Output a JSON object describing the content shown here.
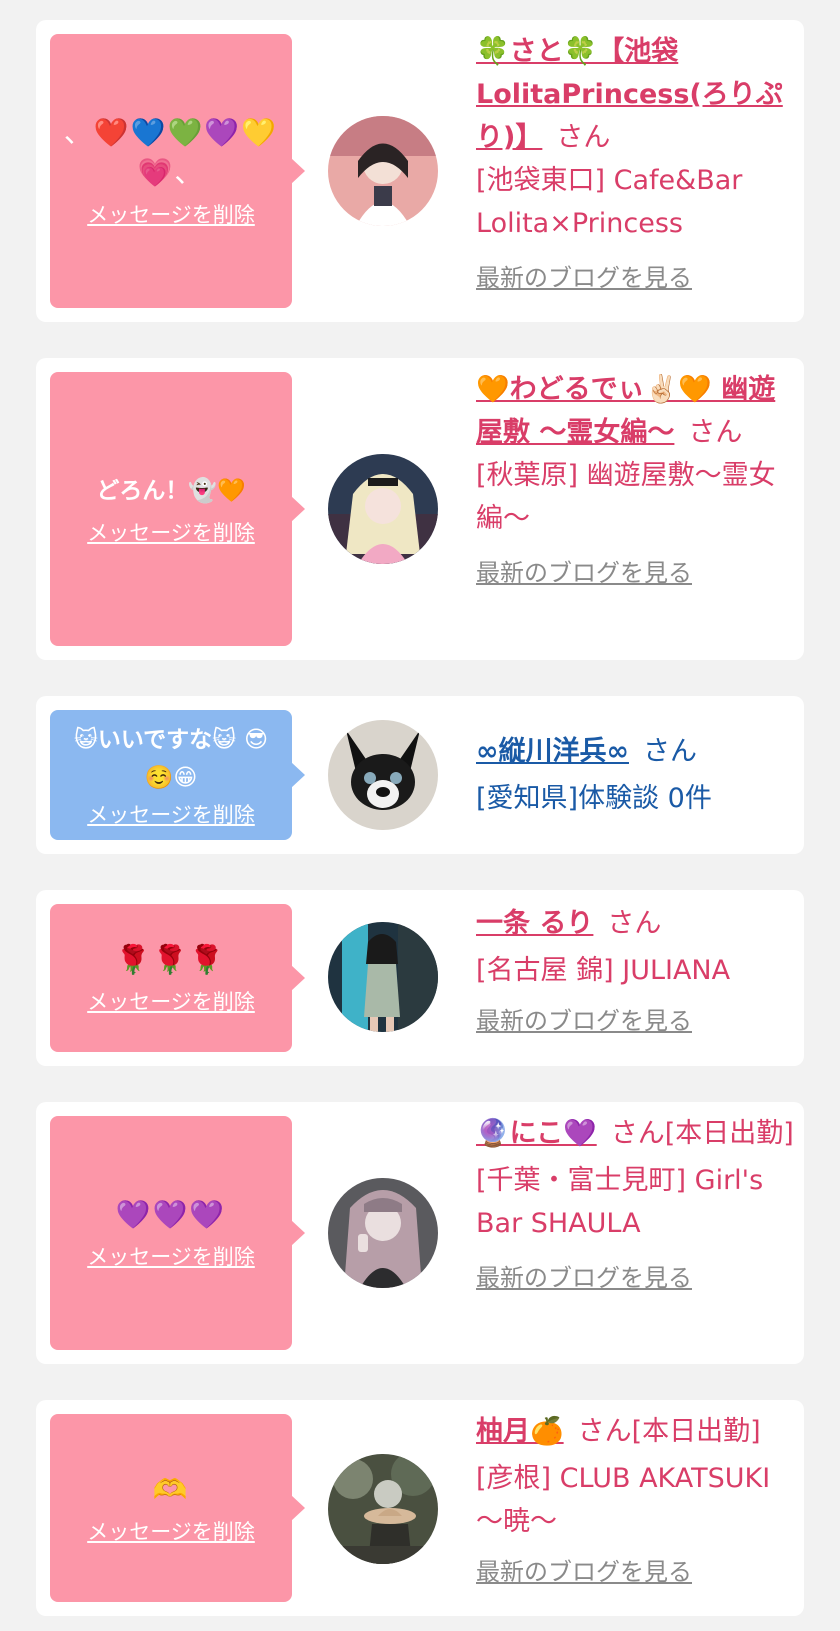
{
  "colors": {
    "pink_bubble": "#fc96a8",
    "blue_bubble": "#8bb8f0",
    "name_pink": "#d93d68",
    "name_blue": "#1a5aa6",
    "link_gray": "#8a8a8a"
  },
  "delete_label": "メッセージを削除",
  "blog_label": "最新のブログを見る",
  "honorific": "さん",
  "cards": [
    {
      "message": "、❤️💙💚💜💛💗、",
      "name": "🍀さと🍀【池袋LolitaPrincess(ろりぷり)】",
      "suffix": "さん",
      "place": "[池袋東口] Cafe&Bar Lolita×Princess",
      "blog": "最新のブログを見る"
    },
    {
      "message": "どろん！👻🧡",
      "name": "🧡わどるでぃ✌🏻🧡 幽遊屋敷 〜霊女編〜",
      "suffix": "さん",
      "place": "[秋葉原] 幽遊屋敷〜霊女編〜",
      "blog": "最新のブログを見る"
    },
    {
      "message": "😺いいですな😺 😎☺️😁",
      "name": "∞縦川洋兵∞",
      "suffix": "さん",
      "place": "[愛知県]体験談 0件"
    },
    {
      "message": "🌹🌹🌹",
      "name": "一条 るり",
      "suffix": "さん",
      "place": "[名古屋 錦] JULIANA",
      "blog": "最新のブログを見る"
    },
    {
      "message": "💜💜💜",
      "name": "🔮にこ💜",
      "suffix": "さん[本日出勤]",
      "place": "[千葉・富士見町] Girl's Bar SHAULA",
      "blog": "最新のブログを見る"
    },
    {
      "message": "🫶",
      "name": "柚月🍊",
      "suffix": "さん[本日出勤]",
      "place": "[彦根] CLUB AKATSUKI 〜暁〜",
      "blog": "最新のブログを見る"
    }
  ]
}
